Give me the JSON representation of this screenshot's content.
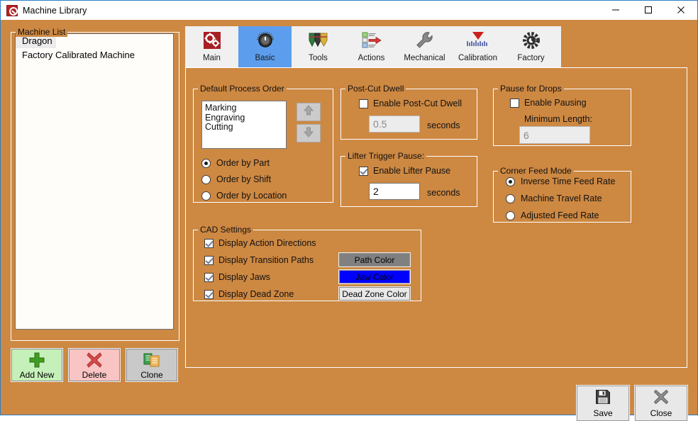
{
  "window": {
    "title": "Machine Library",
    "icon": "app-icon",
    "controls": {
      "minimize": "minimize-icon",
      "maximize": "maximize-icon",
      "close": "close-icon"
    },
    "background_color": "#cd8842",
    "titlebar_color": "#ffffff",
    "border_color": "#2f7fc4"
  },
  "machine_list": {
    "caption": "Machine List",
    "items": [
      {
        "label": "Dragon",
        "selected": true
      },
      {
        "label": "Factory Calibrated Machine",
        "selected": false
      }
    ]
  },
  "list_actions": [
    {
      "name": "add-new-button",
      "label": "Add New",
      "icon": "plus-icon",
      "color": "#c6f0b9"
    },
    {
      "name": "delete-button",
      "label": "Delete",
      "icon": "x-mark-icon",
      "color": "#f9c4c4"
    },
    {
      "name": "clone-button",
      "label": "Clone",
      "icon": "copy-documents-icon",
      "color": "#c9c9c9"
    }
  ],
  "tabs": [
    {
      "id": "main",
      "label": "Main",
      "icon": "red-gears-icon",
      "active": false
    },
    {
      "id": "basic",
      "label": "Basic",
      "icon": "knob-dial-icon",
      "active": true
    },
    {
      "id": "tools",
      "label": "Tools",
      "icon": "marker-tips-icon",
      "active": false
    },
    {
      "id": "actions",
      "label": "Actions",
      "icon": "action-list-arrow-icon",
      "active": false
    },
    {
      "id": "mechanical",
      "label": "Mechanical",
      "icon": "wrench-icon",
      "active": false
    },
    {
      "id": "calibration",
      "label": "Calibration",
      "icon": "red-funnel-ruler-icon",
      "active": false
    },
    {
      "id": "factory",
      "label": "Factory",
      "icon": "dark-gear-icon",
      "active": false
    }
  ],
  "default_process_order": {
    "caption": "Default Process Order",
    "items": [
      "Marking",
      "Engraving",
      "Cutting"
    ],
    "move_up": "up-arrow-icon",
    "move_down": "down-arrow-icon",
    "order_options": [
      {
        "label": "Order by Part",
        "selected": true
      },
      {
        "label": "Order by Shift",
        "selected": false
      },
      {
        "label": "Order by Location",
        "selected": false
      }
    ]
  },
  "post_cut_dwell": {
    "caption": "Post-Cut Dwell",
    "enable_label": "Enable Post-Cut Dwell",
    "enabled": false,
    "value": "0.5",
    "unit": "seconds",
    "field_disabled": true
  },
  "lifter_trigger_pause": {
    "caption": "Lifter Trigger Pause:",
    "enable_label": "Enable Lifter Pause",
    "enabled": true,
    "value": "2",
    "unit": "seconds",
    "field_disabled": false
  },
  "pause_for_drops": {
    "caption": "Pause for Drops",
    "enable_label": "Enable Pausing",
    "enabled": false,
    "minimum_length_label": "Minimum Length:",
    "minimum_length_value": "6",
    "field_disabled": true
  },
  "corner_feed_mode": {
    "caption": "Corner Feed Mode",
    "options": [
      {
        "label": "Inverse Time Feed Rate",
        "selected": true
      },
      {
        "label": "Machine Travel Rate",
        "selected": false
      },
      {
        "label": "Adjusted Feed Rate",
        "selected": false
      }
    ]
  },
  "cad_settings": {
    "caption": "CAD Settings",
    "checkboxes": [
      {
        "label": "Display Action Directions",
        "checked": true
      },
      {
        "label": "Display Transition Paths",
        "checked": true
      },
      {
        "label": "Display Jaws",
        "checked": true
      },
      {
        "label": "Display Dead Zone",
        "checked": true
      }
    ],
    "color_buttons": [
      {
        "label": "Path Color",
        "bg": "#808080",
        "fg": "#000000"
      },
      {
        "label": "Jaw Color",
        "bg": "#0000ff",
        "fg": "#000000"
      },
      {
        "label": "Dead Zone Color",
        "bg": "#e8e8e8",
        "fg": "#000000"
      }
    ]
  },
  "footer_actions": [
    {
      "name": "save-button",
      "label": "Save",
      "icon": "floppy-disk-icon"
    },
    {
      "name": "close-button",
      "label": "Close",
      "icon": "x-mark-icon"
    }
  ]
}
